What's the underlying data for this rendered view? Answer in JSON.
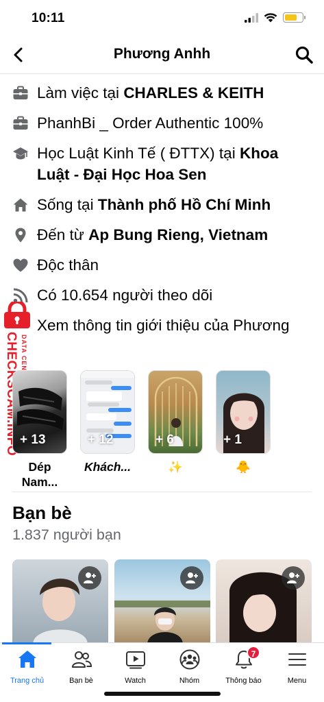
{
  "status": {
    "time": "10:11",
    "battery_level": 0.7,
    "battery_color": "#f4c518"
  },
  "nav": {
    "title": "Phương Anhh"
  },
  "info": [
    {
      "icon": "briefcase-icon",
      "prefix": "Làm việc tại ",
      "bold": "CHARLES & KEITH",
      "suffix": ""
    },
    {
      "icon": "briefcase-icon",
      "prefix": "PhanhBi _ Order Authentic 100%",
      "bold": "",
      "suffix": ""
    },
    {
      "icon": "graduation-cap-icon",
      "prefix": "Học Luật Kinh Tế ( ĐTTX) tại ",
      "bold": "Khoa Luật - Đại Học Hoa Sen",
      "suffix": ""
    },
    {
      "icon": "home-icon",
      "prefix": "Sống tại ",
      "bold": "Thành phố Hồ Chí Minh",
      "suffix": ""
    },
    {
      "icon": "location-pin-icon",
      "prefix": "Đến từ ",
      "bold": "Ap Bung Rieng, Vietnam",
      "suffix": ""
    },
    {
      "icon": "heart-icon",
      "prefix": "Độc thân",
      "bold": "",
      "suffix": ""
    },
    {
      "icon": "rss-icon",
      "prefix": "Có 10.654 người theo dõi",
      "bold": "",
      "suffix": ""
    },
    {
      "icon": "more-dots-icon",
      "prefix": "Xem thông tin giới thiệu của Phương",
      "bold": "",
      "suffix": ""
    }
  ],
  "watermark": {
    "main": "CHECKSCAM.INFO",
    "sub": "DATA CENTER"
  },
  "highlights": [
    {
      "count": "+ 13",
      "label": "Dép Nam..."
    },
    {
      "count": "+ 12",
      "label": "Khách..."
    },
    {
      "count": "+ 6",
      "label": "✨"
    },
    {
      "count": "+ 1",
      "label": "🐥"
    }
  ],
  "friends": {
    "title": "Bạn bè",
    "count": "1.837 người bạn"
  },
  "tabs": [
    {
      "icon": "home-icon",
      "label": "Trang chủ",
      "active": true
    },
    {
      "icon": "friends-icon",
      "label": "Bạn bè"
    },
    {
      "icon": "watch-icon",
      "label": "Watch"
    },
    {
      "icon": "groups-icon",
      "label": "Nhóm"
    },
    {
      "icon": "bell-icon",
      "label": "Thông báo",
      "badge": "7"
    },
    {
      "icon": "menu-icon",
      "label": "Menu"
    }
  ],
  "colors": {
    "accent": "#1877f2",
    "badge": "#e41e3f",
    "watermark": "#e5202a",
    "secondary_text": "#65676b"
  }
}
